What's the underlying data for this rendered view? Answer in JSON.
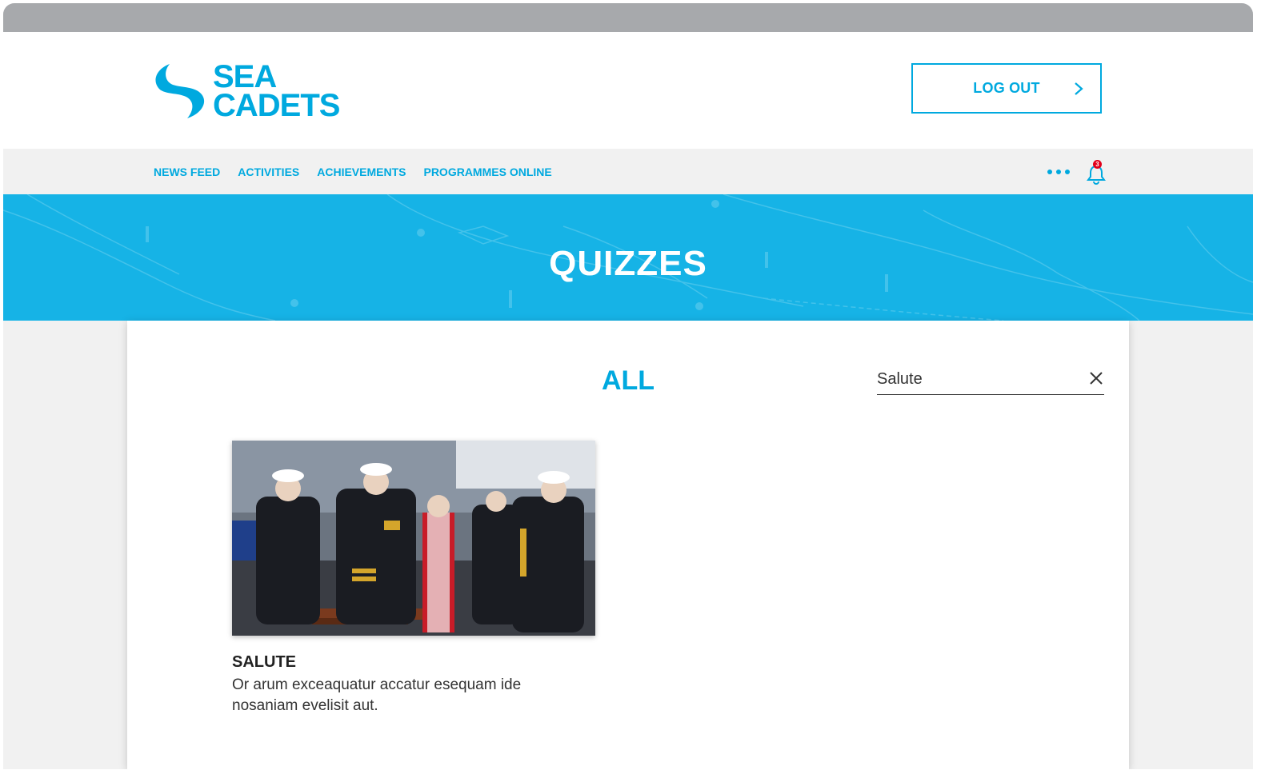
{
  "header": {
    "logo_line1": "SEA",
    "logo_line2": "CADETS",
    "logout_label": "LOG OUT"
  },
  "nav": {
    "items": [
      {
        "label": "NEWS FEED"
      },
      {
        "label": "ACTIVITIES"
      },
      {
        "label": "ACHIEVEMENTS"
      },
      {
        "label": "PROGRAMMES ONLINE"
      }
    ],
    "notification_count": "3",
    "more_icon": "ellipsis-icon",
    "bell_icon": "bell-icon"
  },
  "hero": {
    "title": "QUIZZES"
  },
  "main": {
    "section_title": "ALL",
    "search": {
      "value": "Salute"
    },
    "quizzes": [
      {
        "title": "SALUTE",
        "description": "Or arum exceaquatur accatur esequam ide nosaniam evelisit aut.",
        "image_subject": "naval officers saluting"
      }
    ]
  },
  "colors": {
    "brand": "#00a9df",
    "hero_bg": "#16b3e6",
    "badge": "#e2001a",
    "browser_bar": "#a7a9ac"
  }
}
